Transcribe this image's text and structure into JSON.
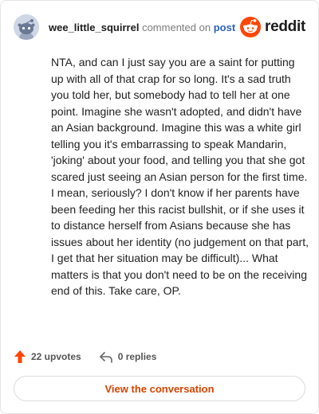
{
  "header": {
    "username": "wee_little_squirrel",
    "action_text": "commented on",
    "post_link": "post",
    "brand": "reddit",
    "brand_color": "#ff4500",
    "avatar_icon": "snoo-avatar-icon"
  },
  "comment": {
    "text": "NTA, and can I just say you are a saint for putting up with all of that crap for so long. It's a sad truth you told her, but somebody had to tell her at one point. Imagine she wasn't adopted, and didn't have an Asian background. Imagine this was a white girl telling you it's embarrassing to speak Mandarin, 'joking' about your food, and telling you that she got scared just seeing an Asian person for the first time. I mean, seriously? I don't know if her parents have been feeding her this racist bullshit, or if she uses it to distance herself from Asians because she has issues about her identity (no judgement on that part, I get that her situation may be difficult)... What matters is that you don't need to be on the receiving end of this. Take care, OP."
  },
  "footer": {
    "upvotes_label": "22 upvotes",
    "replies_label": "0 replies",
    "upvote_icon": "upvote-arrow-icon",
    "reply_icon": "reply-arrow-icon",
    "cta_label": "View the conversation",
    "accent_color": "#d64400"
  }
}
